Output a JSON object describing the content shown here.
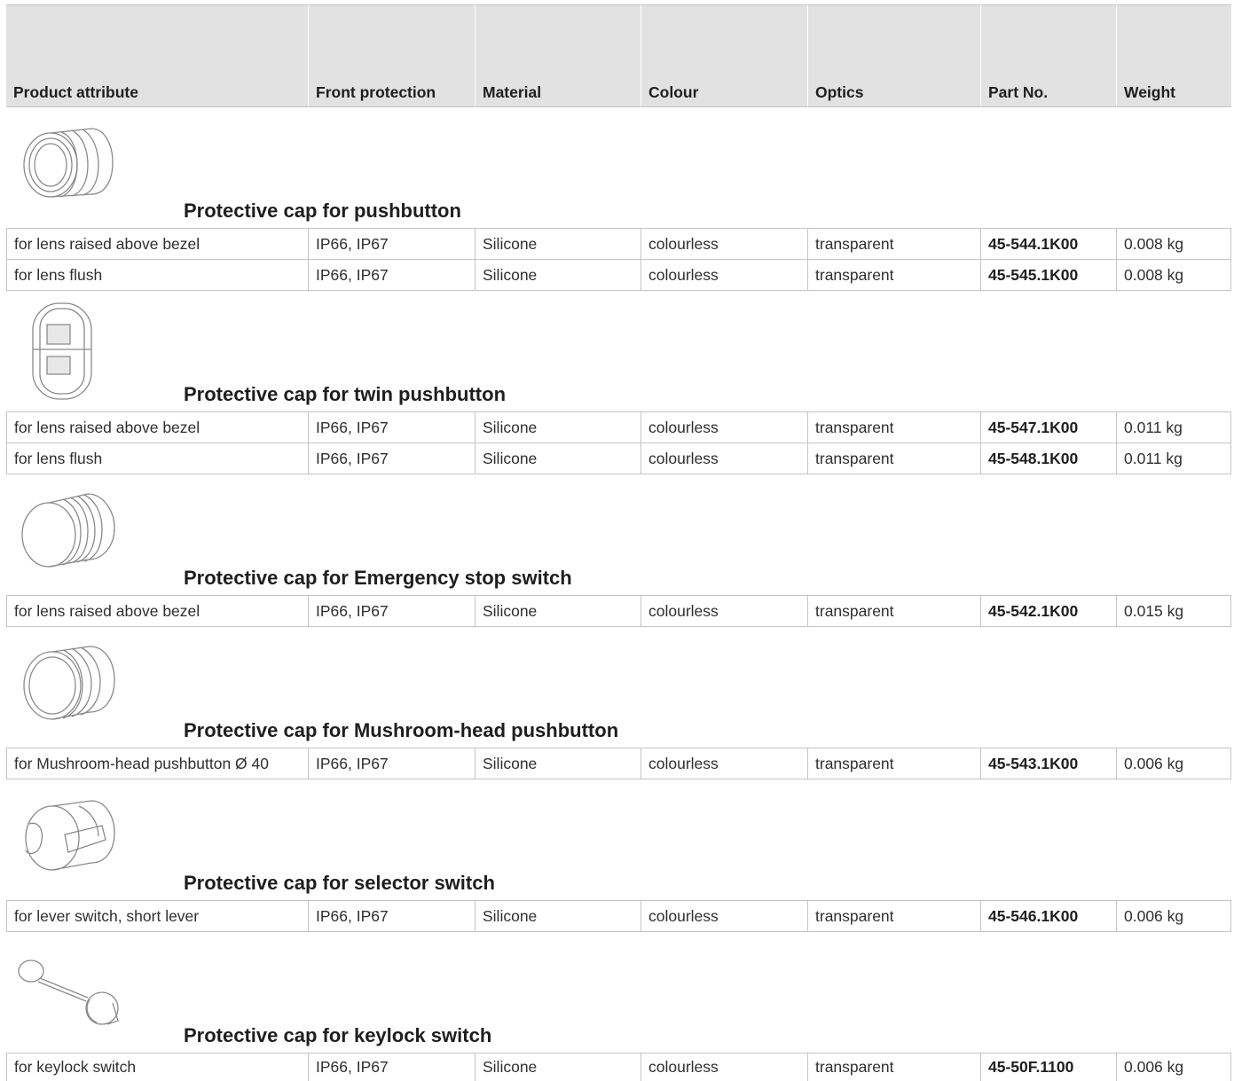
{
  "header": {
    "columns": [
      "Product attribute",
      "Front protection",
      "Material",
      "Colour",
      "Optics",
      "Part No.",
      "Weight"
    ]
  },
  "groups": [
    {
      "title": "Protective cap for pushbutton",
      "icon": "ribbed-cap-icon",
      "rows": [
        [
          "for lens raised above bezel",
          "IP66, IP67",
          "Silicone",
          "colourless",
          "transparent",
          "45-544.1K00",
          "0.008 kg"
        ],
        [
          "for lens flush",
          "IP66, IP67",
          "Silicone",
          "colourless",
          "transparent",
          "45-545.1K00",
          "0.008 kg"
        ]
      ]
    },
    {
      "title": "Protective cap for twin pushbutton",
      "icon": "twin-cap-icon",
      "rows": [
        [
          "for lens raised above bezel",
          "IP66, IP67",
          "Silicone",
          "colourless",
          "transparent",
          "45-547.1K00",
          "0.011 kg"
        ],
        [
          "for lens flush",
          "IP66, IP67",
          "Silicone",
          "colourless",
          "transparent",
          "45-548.1K00",
          "0.011 kg"
        ]
      ]
    },
    {
      "title": "Protective cap for Emergency stop switch",
      "icon": "emergency-cap-icon",
      "rows": [
        [
          "for lens raised above bezel",
          "IP66, IP67",
          "Silicone",
          "colourless",
          "transparent",
          "45-542.1K00",
          "0.015 kg"
        ]
      ]
    },
    {
      "title": "Protective cap for Mushroom-head pushbutton",
      "icon": "mushroom-cap-icon",
      "rows": [
        [
          "for Mushroom-head pushbutton Ø 40",
          "IP66, IP67",
          "Silicone",
          "colourless",
          "transparent",
          "45-543.1K00",
          "0.006 kg"
        ]
      ]
    },
    {
      "title": "Protective cap for selector switch",
      "icon": "selector-cap-icon",
      "rows": [
        [
          "for lever switch, short lever",
          "IP66, IP67",
          "Silicone",
          "colourless",
          "transparent",
          "45-546.1K00",
          "0.006 kg"
        ]
      ]
    },
    {
      "title": "Protective cap for keylock switch",
      "icon": "keylock-cap-icon",
      "rows": [
        [
          "for keylock switch",
          "IP66, IP67",
          "Silicone",
          "colourless",
          "transparent",
          "45-50F.1100",
          "0.006 kg"
        ]
      ]
    }
  ]
}
